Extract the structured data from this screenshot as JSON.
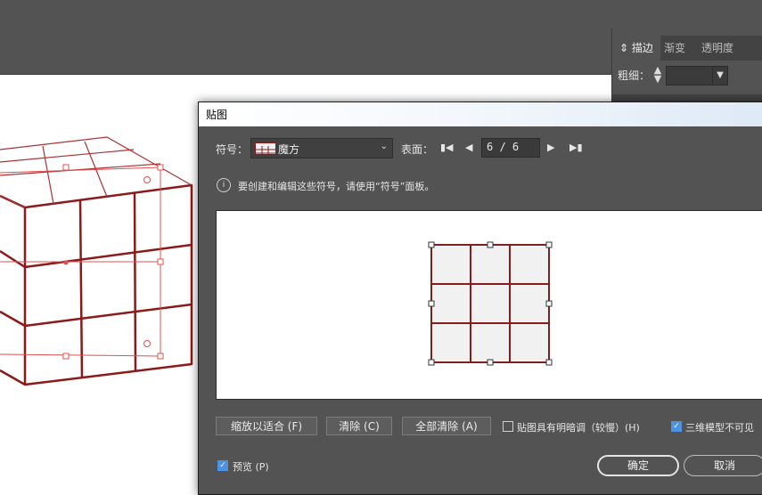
{
  "panel": {
    "tabs": [
      "描边",
      "渐变",
      "透明度"
    ],
    "weight_label": "粗细："
  },
  "dialog": {
    "title": "贴图",
    "symbol_label": "符号：",
    "symbol_value": "魔方",
    "surface_label": "表面：",
    "page_value": "6 / 6",
    "info_text": "要创建和编辑这些符号，请使用“符号”面板。",
    "buttons": {
      "fit": "缩放以适合 (F)",
      "clear": "清除 (C)",
      "clear_all": "全部清除 (A)"
    },
    "shade_label": "贴图具有明暗调（较慢）(H)",
    "shade_checked": false,
    "invisible_label": "三维模型不可见",
    "invisible_checked": true,
    "preview_label": "预览 (P)",
    "preview_checked": true,
    "ok_label": "确定",
    "cancel_label": "取消"
  },
  "colors": {
    "cube_stroke": "#8b1a1a",
    "cube_fill": "#f1f1f1",
    "panel_bg": "#535353",
    "check_blue": "#4d93e5"
  }
}
